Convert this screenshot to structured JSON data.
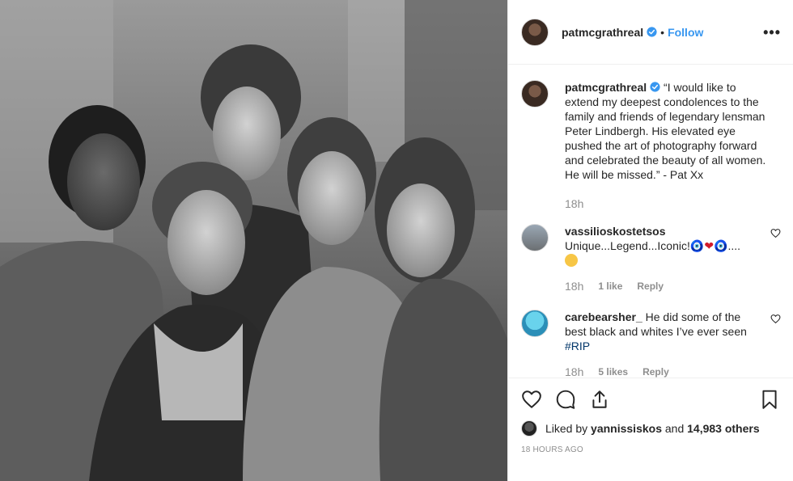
{
  "post": {
    "author": "patmcgrathreal",
    "separator": "•",
    "follow_label": "Follow",
    "more_label": "•••"
  },
  "caption": {
    "username": "patmcgrathreal",
    "text": "“I would like to extend my deepest condolences to the family and friends of legendary lensman Peter Lindbergh. His elevated eye pushed the art of photography forward and celebrated the beauty of all women. He will be missed.” - Pat Xx",
    "time": "18h"
  },
  "comments": [
    {
      "username": "vassilioskostetsos",
      "text_before": "Unique...Legend...Iconic!",
      "emoji_blue": "🧿",
      "emoji_heart": "❤",
      "emoji_blue2": "🧿",
      "text_after": "....",
      "time": "18h",
      "likes": "1 like",
      "reply": "Reply"
    },
    {
      "username": "carebearsher_",
      "text": "He did some of the best black and whites I’ve ever seen",
      "hashtag": "#RIP",
      "time": "18h",
      "likes": "5 likes",
      "reply": "Reply"
    }
  ],
  "footer": {
    "liked_prefix": "Liked by",
    "liked_user": "yannissiskos",
    "liked_and": "and",
    "liked_others": "14,983 others",
    "timestamp": "18 HOURS AGO"
  },
  "icons": {
    "verified": "verified-badge-icon",
    "like": "heart-icon",
    "comment": "comment-bubble-icon",
    "share": "share-icon",
    "save": "bookmark-icon",
    "comment_like": "small-heart-icon"
  },
  "colors": {
    "link_blue": "#3897f0",
    "verified_blue": "#3897f0",
    "muted": "#8e8e8e",
    "text": "#262626",
    "hashtag": "#003569"
  }
}
